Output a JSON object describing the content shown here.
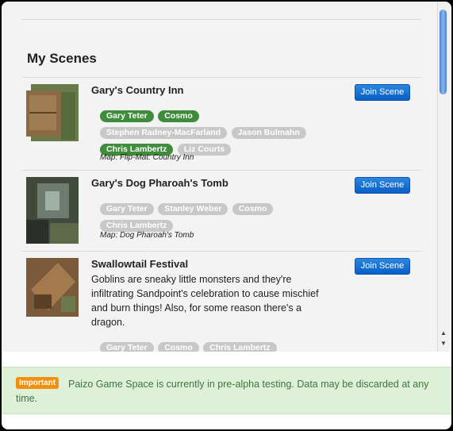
{
  "page": {
    "section_title": "My Scenes"
  },
  "scenes": [
    {
      "title": "Gary's Country Inn",
      "join_label": "Join Scene",
      "players": [
        {
          "name": "Gary Teter",
          "active": true
        },
        {
          "name": "Cosmo",
          "active": true
        },
        {
          "name": "Stephen Radney-MacFarland",
          "active": false
        },
        {
          "name": "Jason Bulmahn",
          "active": false
        },
        {
          "name": "Chris Lambertz",
          "active": true
        },
        {
          "name": "Liz Courts",
          "active": false
        }
      ],
      "map": "Map: Flip-Mat: Country Inn"
    },
    {
      "title": "Gary's Dog Pharoah's Tomb",
      "join_label": "Join Scene",
      "players": [
        {
          "name": "Gary Teter",
          "active": false
        },
        {
          "name": "Stanley Weber",
          "active": false
        },
        {
          "name": "Cosmo",
          "active": false
        },
        {
          "name": "Chris Lambertz",
          "active": false
        }
      ],
      "map": "Map: Dog Pharoah's Tomb"
    },
    {
      "title": "Swallowtail Festival",
      "join_label": "Join Scene",
      "description": "Goblins are sneaky little monsters and they're infiltrating Sandpoint's celebration to cause mischief and burn things! Also, for some reason there's a dragon.",
      "players": [
        {
          "name": "Gary Teter",
          "active": false
        },
        {
          "name": "Cosmo",
          "active": false
        },
        {
          "name": "Chris Lambertz",
          "active": false
        }
      ]
    }
  ],
  "notice": {
    "badge": "Important",
    "text": "Paizo Game Space is currently in pre-alpha testing. Data may be discarded at any time."
  },
  "colors": {
    "active_tag": "#3e8c3c",
    "inactive_tag": "#c8c8c8",
    "button": "#0a5fc4",
    "badge": "#f0900c",
    "notice_bg": "#dff0d8"
  },
  "icons": {
    "scroll_up": "arrow-up-icon",
    "scroll_down": "arrow-down-icon"
  }
}
